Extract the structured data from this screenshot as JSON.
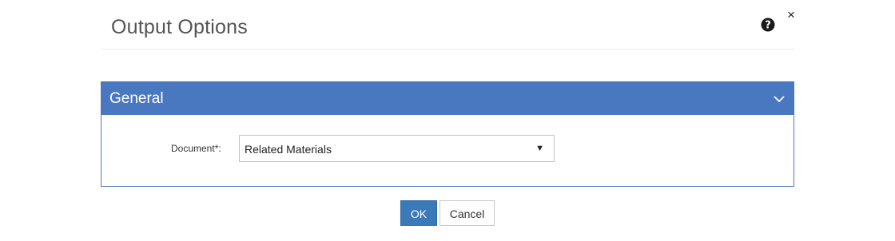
{
  "dialog": {
    "title": "Output Options",
    "help_icon": "question-circle-icon",
    "close_label": "×"
  },
  "panel": {
    "title": "General",
    "chevron_icon": "chevron-down-icon",
    "header_color": "#4a78c0"
  },
  "form": {
    "document_label": "Document*:",
    "document_value": "Related Materials",
    "dropdown_arrow": "▼"
  },
  "buttons": {
    "ok_label": "OK",
    "cancel_label": "Cancel",
    "ok_color": "#3a7ab8"
  }
}
